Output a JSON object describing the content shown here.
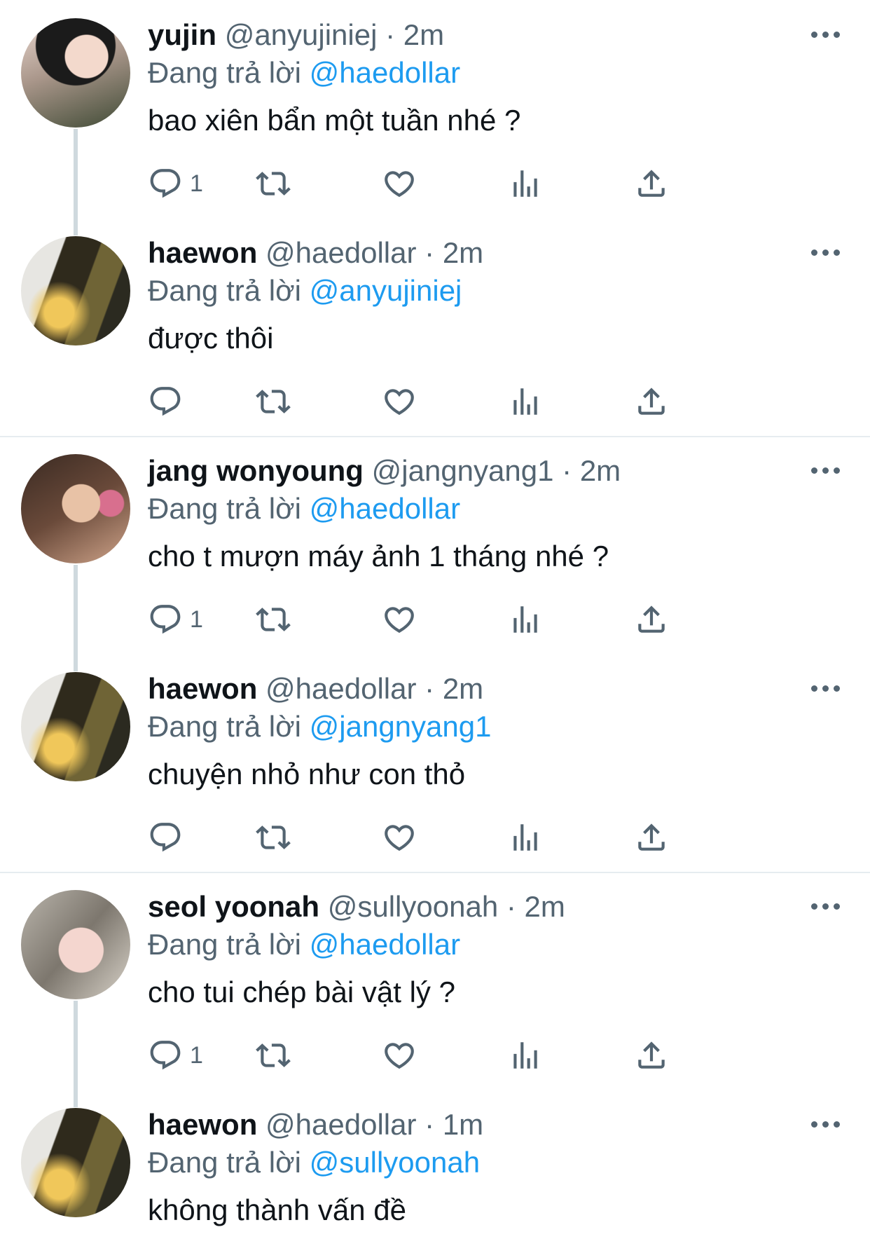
{
  "reply_prefix": "Đang trả lời",
  "tweets": [
    {
      "name": "yujin",
      "handle": "@anyujiniej",
      "dot": "·",
      "time": "2m",
      "reply_to": "@haedollar",
      "text": "bao xiên bẩn một tuần nhé ?",
      "reply_count": "1"
    },
    {
      "name": "haewon",
      "handle": "@haedollar",
      "dot": "·",
      "time": "2m",
      "reply_to": "@anyujiniej",
      "text": "được thôi",
      "reply_count": ""
    },
    {
      "name": "jang wonyoung",
      "handle": "@jangnyang1",
      "dot": "·",
      "time": "2m",
      "reply_to": "@haedollar",
      "text": "cho t mượn máy ảnh 1 tháng nhé ?",
      "reply_count": "1"
    },
    {
      "name": "haewon",
      "handle": "@haedollar",
      "dot": "·",
      "time": "2m",
      "reply_to": "@jangnyang1",
      "text": "chuyện nhỏ như con thỏ",
      "reply_count": ""
    },
    {
      "name": "seol yoonah",
      "handle": "@sullyoonah",
      "dot": "·",
      "time": "2m",
      "reply_to": "@haedollar",
      "text": "cho tui chép bài vật lý ?",
      "reply_count": "1"
    },
    {
      "name": "haewon",
      "handle": "@haedollar",
      "dot": "·",
      "time": "1m",
      "reply_to": "@sullyoonah",
      "text": "không thành vấn đề",
      "reply_count": ""
    }
  ],
  "icons": {
    "reply": "reply-icon",
    "retweet": "retweet-icon",
    "like": "heart-icon",
    "views": "views-icon",
    "share": "share-icon",
    "more": "more-icon"
  },
  "colors": {
    "mention": "#1d9bf0",
    "secondary": "#536471",
    "thread_line": "#cfd9de"
  }
}
